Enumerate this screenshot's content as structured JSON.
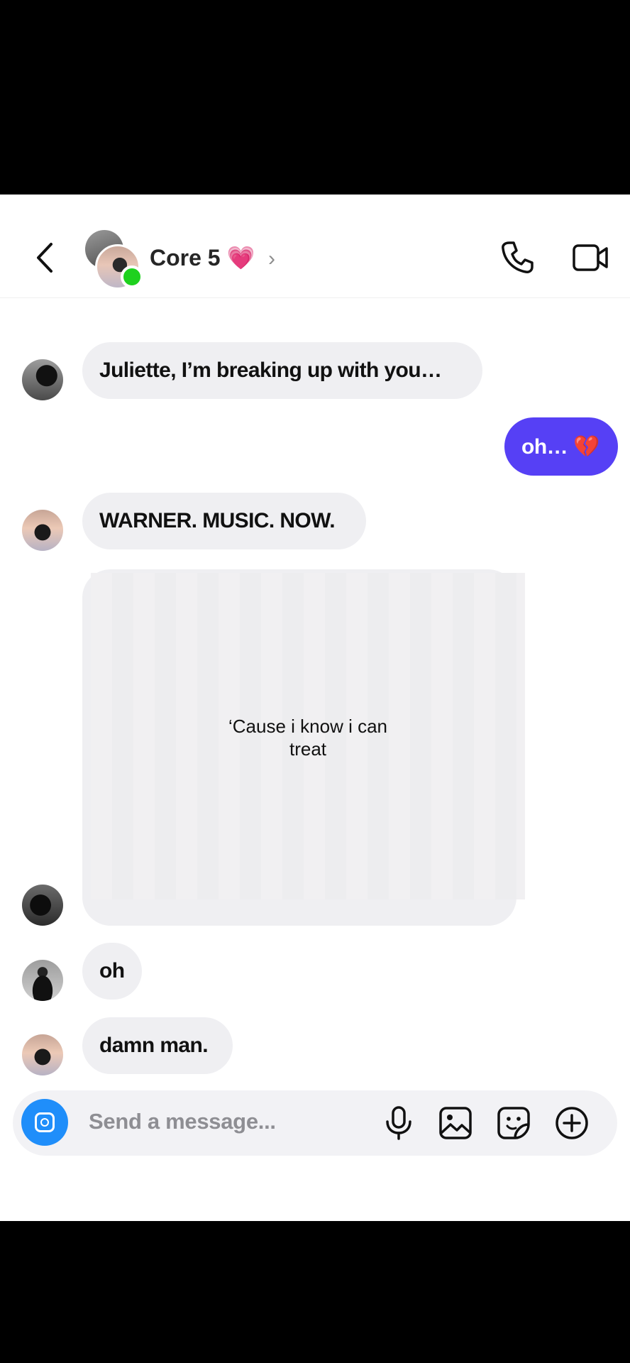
{
  "header": {
    "title": "Core 5 💗",
    "chevron": "›"
  },
  "messages": {
    "m1": "Juliette, I’m breaking up with you…",
    "m2": "oh… 💔",
    "m3": "WARNER. MUSIC. NOW.",
    "media_caption": "‘Cause i know i can\ntreat",
    "m4": "oh",
    "m5": "damn man."
  },
  "composer": {
    "placeholder": "Send a message..."
  },
  "colors": {
    "sent_bubble": "#5640f5",
    "received_bubble": "#efeff2",
    "camera_button": "#1f8efa",
    "online_dot": "#1ed11e"
  },
  "icons": [
    "back-icon",
    "phone-icon",
    "video-call-icon",
    "camera-icon",
    "microphone-icon",
    "gallery-icon",
    "sticker-icon",
    "plus-circle-icon"
  ]
}
